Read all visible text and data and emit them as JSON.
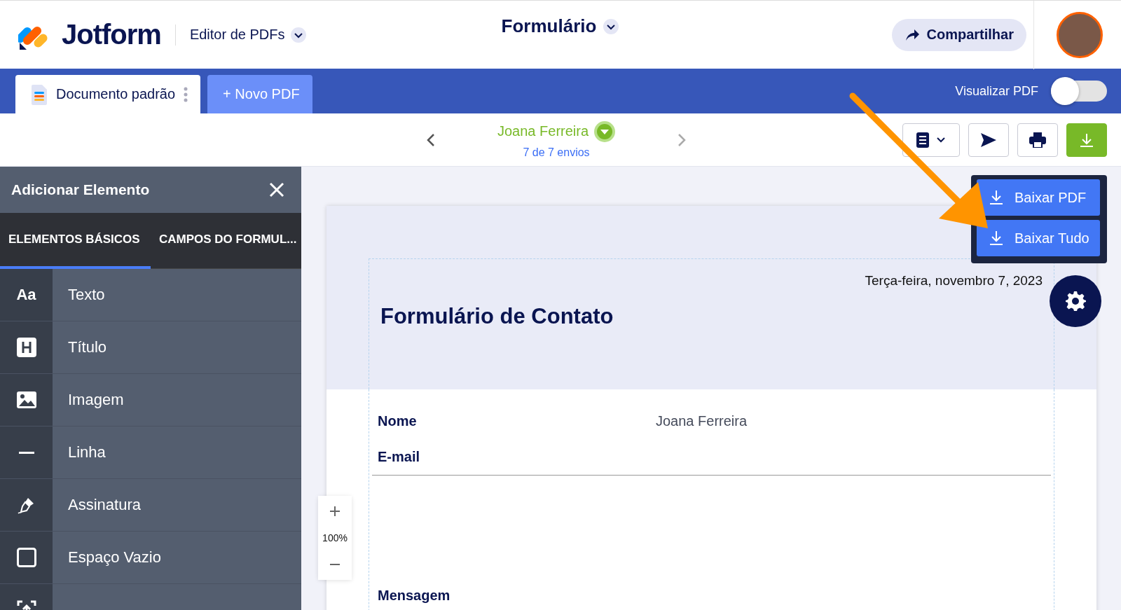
{
  "header": {
    "logo_text": "Jotform",
    "product": "Editor de PDFs",
    "form_title": "Formulário",
    "share_button": "Compartilhar"
  },
  "tabs": [
    {
      "label": "Documento padrão",
      "selected": true
    },
    {
      "label": "+ Novo PDF",
      "selected": false
    }
  ],
  "preview_toggle": {
    "label": "Visualizar PDF",
    "on": false
  },
  "submission": {
    "name": "Joana Ferreira",
    "counter": "7 de 7 envios"
  },
  "download_menu": [
    "Baixar PDF",
    "Baixar Tudo"
  ],
  "sidebar": {
    "title": "Adicionar Elemento",
    "tabs": [
      {
        "label": "ELEMENTOS BÁSICOS",
        "selected": true
      },
      {
        "label": "CAMPOS DO FORMUL...",
        "selected": false
      }
    ],
    "items": [
      {
        "label": "Texto",
        "kind": "text",
        "icon_text": "Aa"
      },
      {
        "label": "Título",
        "kind": "heading"
      },
      {
        "label": "Imagem",
        "kind": "image"
      },
      {
        "label": "Linha",
        "kind": "line"
      },
      {
        "label": "Assinatura",
        "kind": "signature"
      },
      {
        "label": "Espaço Vazio",
        "kind": "spacer"
      },
      {
        "kind": "box"
      }
    ]
  },
  "document": {
    "date": "Terça-feira, novembro 7, 2023",
    "title": "Formulário de Contato",
    "fields": [
      {
        "label": "Nome",
        "value": "Joana Ferreira"
      },
      {
        "label": "E-mail"
      },
      {
        "label": "Mensagem"
      }
    ]
  },
  "zoom": "100%"
}
